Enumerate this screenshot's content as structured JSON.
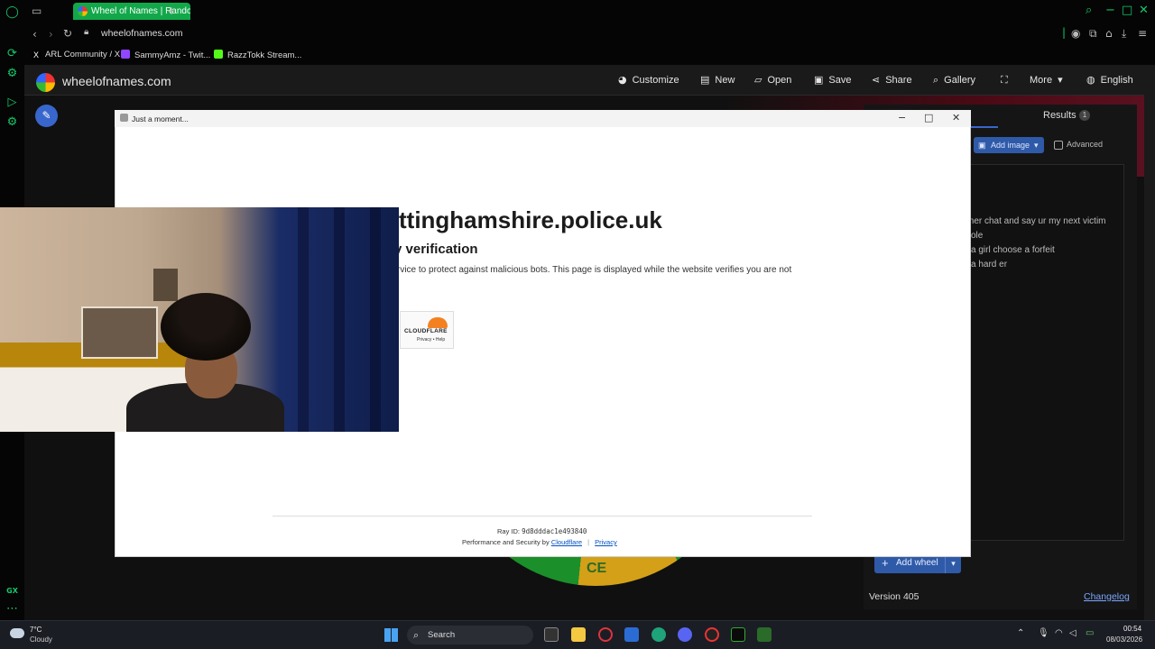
{
  "browser": {
    "tab_title": "Wheel of Names | Random",
    "url": "wheelofnames.com",
    "bookmarks": [
      {
        "label": "ARL Community / X"
      },
      {
        "label": "SammyAmz - Twit..."
      },
      {
        "label": "RazzTokk Stream..."
      }
    ],
    "sidebar_label_gx": "GX"
  },
  "site": {
    "name": "wheelofnames.com",
    "nav": [
      {
        "label": "Customize",
        "icon": "palette-icon"
      },
      {
        "label": "New",
        "icon": "new-doc-icon"
      },
      {
        "label": "Open",
        "icon": "folder-icon"
      },
      {
        "label": "Save",
        "icon": "save-icon"
      },
      {
        "label": "Share",
        "icon": "share-icon"
      },
      {
        "label": "Gallery",
        "icon": "search-icon"
      },
      {
        "label": "More",
        "icon": "caret-down-icon"
      },
      {
        "label": "English",
        "icon": "globe-icon"
      }
    ],
    "results_tab": "Results",
    "results_count": "1",
    "add_image": "Add image",
    "advanced": "Advanced",
    "entries": [
      "mer chat and say ur my next victim",
      "ole",
      "a girl choose a forfeit",
      " a hard er"
    ],
    "add_wheel": "Add wheel",
    "version": "Version 405",
    "changelog": "Changelog",
    "wheel_text": "CE"
  },
  "popup": {
    "title": "Just a moment...",
    "domain": "ttinghamshire.police.uk",
    "subheading": "y verification",
    "body": "rvice to protect against malicious bots. This page is displayed while the website verifies you are not",
    "cloudflare_word": "CLOUDFLARE",
    "cloudflare_links": "Privacy • Help",
    "ray_label": "Ray ID:",
    "ray_id": "9d8dddac1e493840",
    "perf_text": "Performance and Security by",
    "cloudflare_link": "Cloudflare",
    "separator": "|",
    "privacy_link": "Privacy"
  },
  "taskbar": {
    "weather_temp": "7°C",
    "weather_desc": "Cloudy",
    "search_placeholder": "Search",
    "time": "00:54",
    "date": "08/03/2026"
  }
}
